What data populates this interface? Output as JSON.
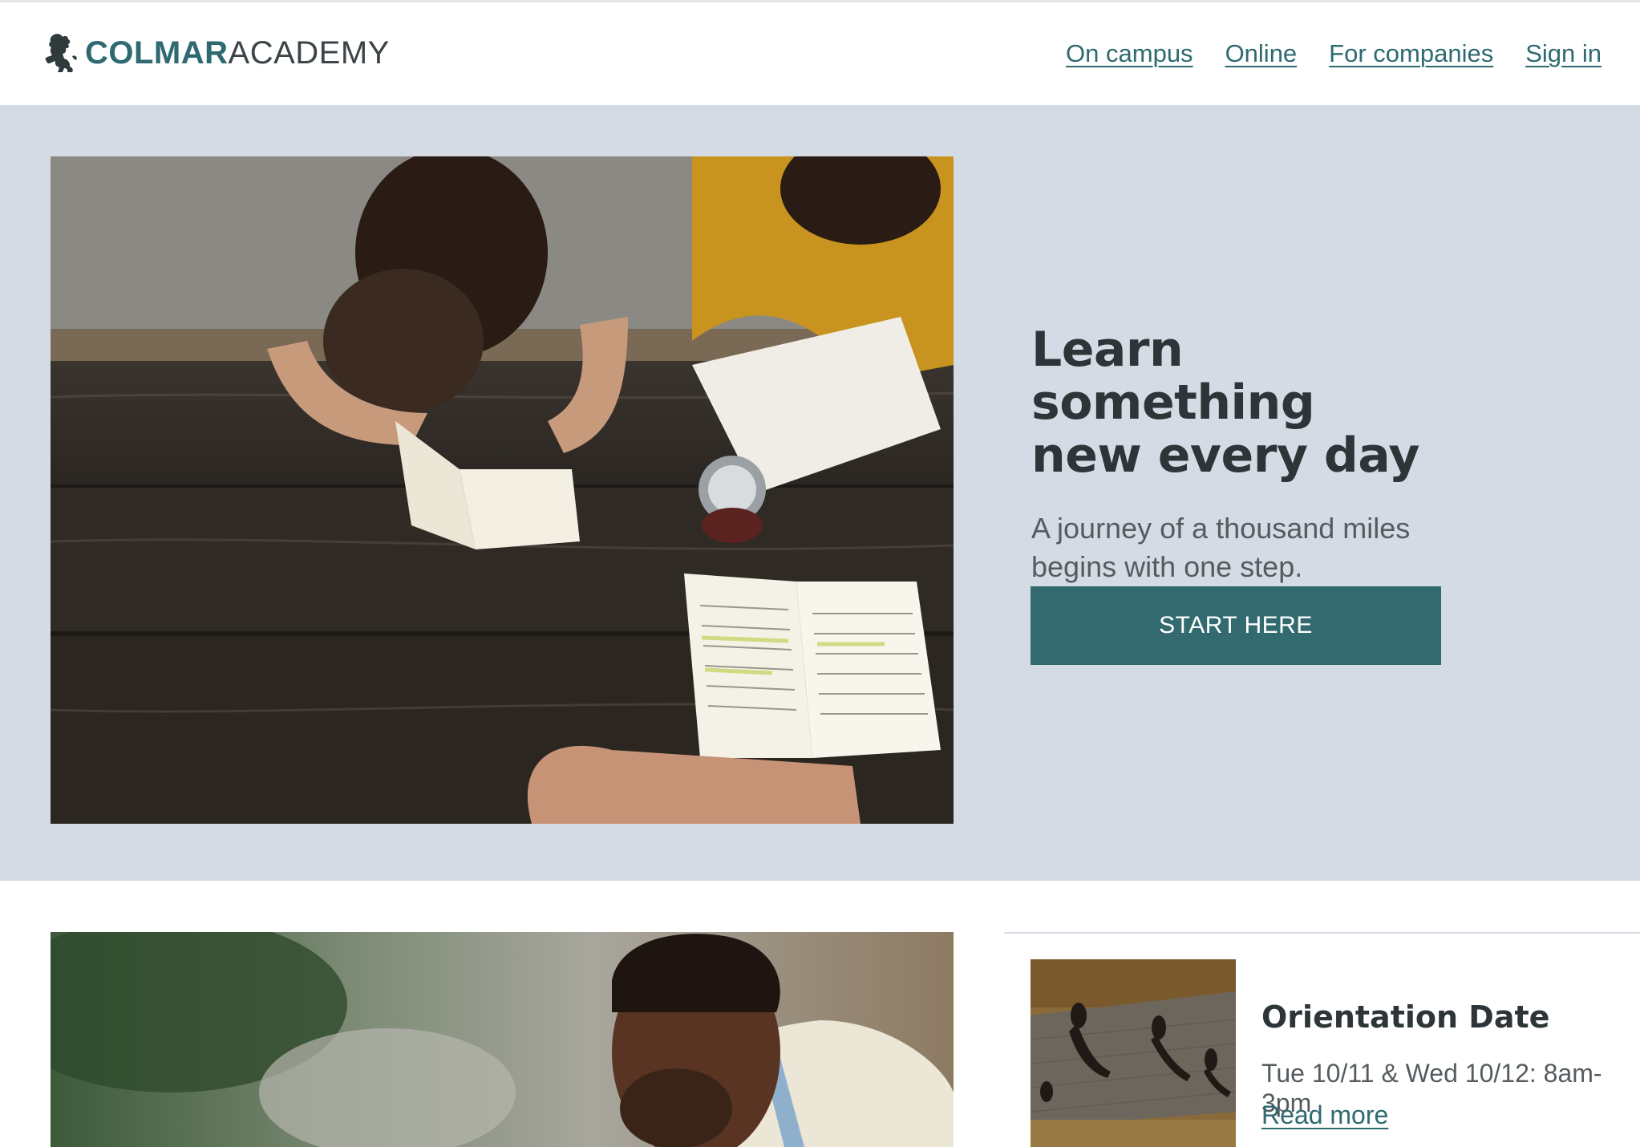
{
  "brand": {
    "name_bold": "COLMAR",
    "name_light": "ACADEMY",
    "icon": "lion-rampant-icon"
  },
  "nav": {
    "items": [
      {
        "label": "On campus"
      },
      {
        "label": "Online"
      },
      {
        "label": "For companies"
      },
      {
        "label": "Sign in"
      }
    ]
  },
  "hero": {
    "title_line1": "Learn something",
    "title_line2": "new every day",
    "subtitle_line1": "A journey of a thousand miles",
    "subtitle_line2": "begins with one step.",
    "cta_label": "START HERE",
    "image": "students-reading-at-wooden-table-photo"
  },
  "feature": {
    "image": "smiling-student-outdoors-photo"
  },
  "event": {
    "title": "Orientation Date",
    "date": "Tue 10/11 & Wed 10/12: 8am-3pm",
    "link_label": "Read more",
    "image": "aerial-people-walking-photo"
  },
  "colors": {
    "brand_teal": "#336a70",
    "hero_bg": "#d4dbe5",
    "heading": "#2e3538",
    "body_text": "#555c5f"
  }
}
